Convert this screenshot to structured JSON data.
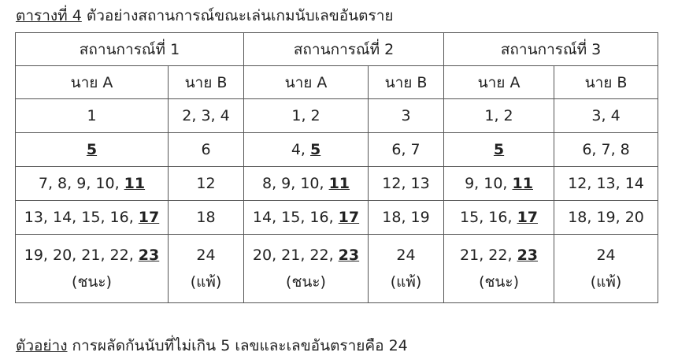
{
  "caption": {
    "lead": "ตารางที่ 4",
    "text": " ตัวอย่างสถานการณ์ขณะเล่นเกมนับเลขอันตราย"
  },
  "scenarios": [
    "สถานการณ์ที่ 1",
    "สถานการณ์ที่ 2",
    "สถานการณ์ที่ 3"
  ],
  "players": [
    "นาย A",
    "นาย B",
    "นาย A",
    "นาย B",
    "นาย A",
    "นาย B"
  ],
  "rows": [
    [
      {
        "pre": "1",
        "key": ""
      },
      {
        "pre": "2, 3, 4",
        "key": ""
      },
      {
        "pre": "1, 2",
        "key": ""
      },
      {
        "pre": "3",
        "key": ""
      },
      {
        "pre": "1, 2",
        "key": ""
      },
      {
        "pre": "3, 4",
        "key": ""
      }
    ],
    [
      {
        "pre": "",
        "key": "5"
      },
      {
        "pre": "6",
        "key": ""
      },
      {
        "pre": "4, ",
        "key": "5"
      },
      {
        "pre": "6, 7",
        "key": ""
      },
      {
        "pre": "",
        "key": "5"
      },
      {
        "pre": "6, 7, 8",
        "key": ""
      }
    ],
    [
      {
        "pre": "7, 8, 9, 10, ",
        "key": "11"
      },
      {
        "pre": "12",
        "key": ""
      },
      {
        "pre": "8, 9, 10, ",
        "key": "11"
      },
      {
        "pre": "12, 13",
        "key": ""
      },
      {
        "pre": "9, 10, ",
        "key": "11"
      },
      {
        "pre": "12, 13, 14",
        "key": ""
      }
    ],
    [
      {
        "pre": "13, 14, 15, 16, ",
        "key": "17"
      },
      {
        "pre": "18",
        "key": ""
      },
      {
        "pre": "14, 15, 16, ",
        "key": "17"
      },
      {
        "pre": "18, 19",
        "key": ""
      },
      {
        "pre": "15, 16, ",
        "key": "17"
      },
      {
        "pre": "18, 19, 20",
        "key": ""
      }
    ]
  ],
  "final_row": [
    {
      "pre": "19, 20, 21, 22, ",
      "key": "23",
      "result": "(ชนะ)"
    },
    {
      "pre": "24",
      "key": "",
      "result": "(แพ้)"
    },
    {
      "pre": "20, 21, 22, ",
      "key": "23",
      "result": "(ชนะ)"
    },
    {
      "pre": "24",
      "key": "",
      "result": "(แพ้)"
    },
    {
      "pre": "21, 22, ",
      "key": "23",
      "result": "(ชนะ)"
    },
    {
      "pre": "24",
      "key": "",
      "result": "(แพ้)"
    }
  ],
  "footnote": {
    "lead": "ตัวอย่าง",
    "text": " การผลัดกันนับที่ไม่เกิน 5 เลขและเลขอันตรายคือ 24"
  }
}
